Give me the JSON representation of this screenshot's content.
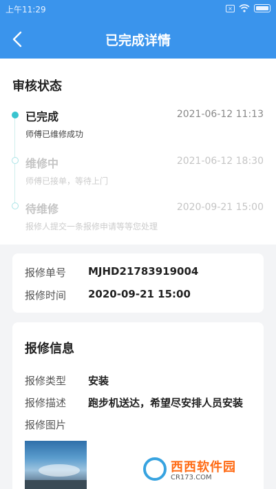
{
  "statusbar": {
    "time": "上午11:29"
  },
  "header": {
    "title": "已完成详情"
  },
  "review": {
    "title": "审核状态",
    "steps": [
      {
        "title": "已完成",
        "desc": "师傅已维修成功",
        "time": "2021-06-12 11:13"
      },
      {
        "title": "维修中",
        "desc": "师傅已接单，等待上门",
        "time": "2021-06-12 18:30"
      },
      {
        "title": "待维修",
        "desc": "报修人提交一条报修申请等等您处理",
        "time": "2020-09-21 15:00"
      }
    ]
  },
  "order": {
    "number_label": "报修单号",
    "number_value": "MJHD21783919004",
    "time_label": "报修时间",
    "time_value": "2020-09-21 15:00"
  },
  "info": {
    "title": "报修信息",
    "type_label": "报修类型",
    "type_value": "安装",
    "desc_label": "报修描述",
    "desc_value": "跑步机送达，希望尽安排人员安装",
    "image_label": "报修图片"
  },
  "watermark": {
    "main": "西西软件园",
    "sub": "CR173.COM"
  },
  "colors": {
    "header": "#3a94ec",
    "timeline": "#39c4cf"
  }
}
